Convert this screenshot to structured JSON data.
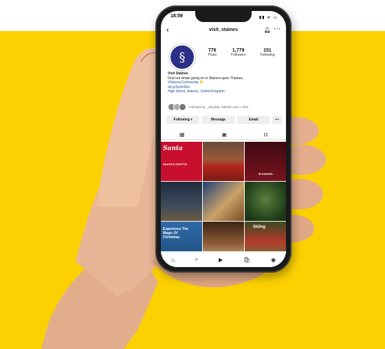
{
  "status": {
    "time": "18:59",
    "icons": "▮▮ ᯤ ▭"
  },
  "profile": {
    "username": "visit_staines",
    "stats": [
      {
        "value": "776",
        "label": "Posts"
      },
      {
        "value": "1,779",
        "label": "Followers"
      },
      {
        "value": "151",
        "label": "Following"
      }
    ],
    "name": "Visit Staines",
    "bio": "Find out whats going on in Staines-upon-Thames.",
    "hashtag": "#StainesCommunity 👇",
    "link": "bit.ly/3z0m50n",
    "location": "High Street, Staines, United Kingdom",
    "followed_by": "Followed by _claudiab, stthelen and 1 other"
  },
  "buttons": {
    "following": "Following ▾",
    "message": "Message",
    "email": "Email",
    "more": "+⁴"
  },
  "grid": {
    "santa_title": "Santa",
    "santa_sub": "SANTA'S GROTTO",
    "experience_text": "Experience The Magic Of Christmas",
    "skiing_text": "Skiing",
    "sammy_text": "M·SAMUEL"
  },
  "icons": {
    "back": "back-arrow-icon",
    "bell": "bell-icon",
    "more": "more-dots-icon",
    "grid": "grid-icon",
    "reels": "reels-icon",
    "tagged": "tagged-icon",
    "home": "home-icon",
    "search": "search-icon",
    "reel": "reel-icon",
    "shop": "shop-icon",
    "profile": "profile-icon"
  },
  "colors": {
    "background_band": "#fcd102",
    "avatar": "#2b2f86",
    "santa_red": "#c8102e"
  }
}
